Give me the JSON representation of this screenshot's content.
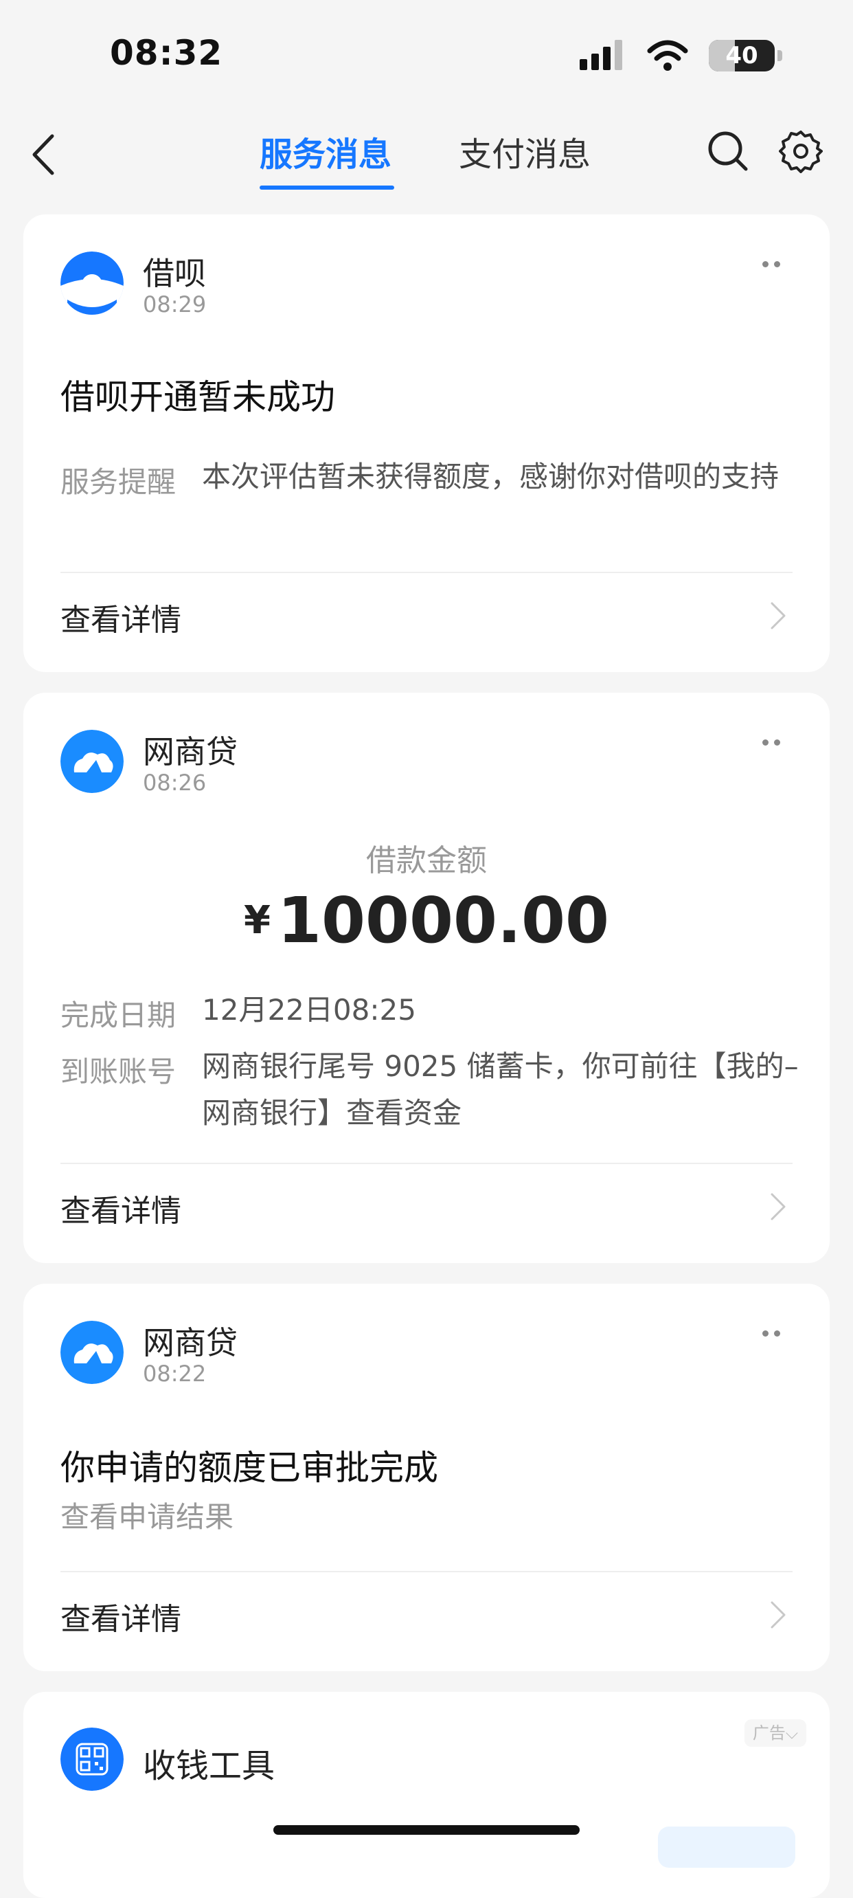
{
  "status_bar": {
    "time": "08:32",
    "battery": "40",
    "battery_level": 0.4
  },
  "nav": {
    "tabs": [
      {
        "label": "服务消息",
        "active": true
      },
      {
        "label": "支付消息",
        "active": false
      }
    ]
  },
  "colors": {
    "accent": "#1677ff",
    "card_bg": "#ffffff",
    "page_bg": "#f5f5f5"
  },
  "cards": [
    {
      "source": "借呗",
      "time": "08:29",
      "icon": "jiebei-logo-icon",
      "title": "借呗开通暂未成功",
      "row_label": "服务提醒",
      "row_value": "本次评估暂未获得额度，感谢你对借呗的支持",
      "detail_label": "查看详情"
    },
    {
      "source": "网商贷",
      "time": "08:26",
      "icon": "wangshangdai-logo-icon",
      "amount_label": "借款金额",
      "currency": "¥",
      "amount": "10000.00",
      "rows": [
        {
          "label": "完成日期",
          "value": "12月22日08:25"
        },
        {
          "label": "到账账号",
          "value": "网商银行尾号 9025 储蓄卡，你可前往【我的–网商银行】查看资金"
        }
      ],
      "detail_label": "查看详情"
    },
    {
      "source": "网商贷",
      "time": "08:22",
      "icon": "wangshangdai-logo-icon",
      "title": "你申请的额度已审批完成",
      "subtitle": "查看申请结果",
      "detail_label": "查看详情"
    },
    {
      "source": "收钱工具",
      "icon": "qr-code-icon",
      "ad_badge": "广告"
    }
  ]
}
